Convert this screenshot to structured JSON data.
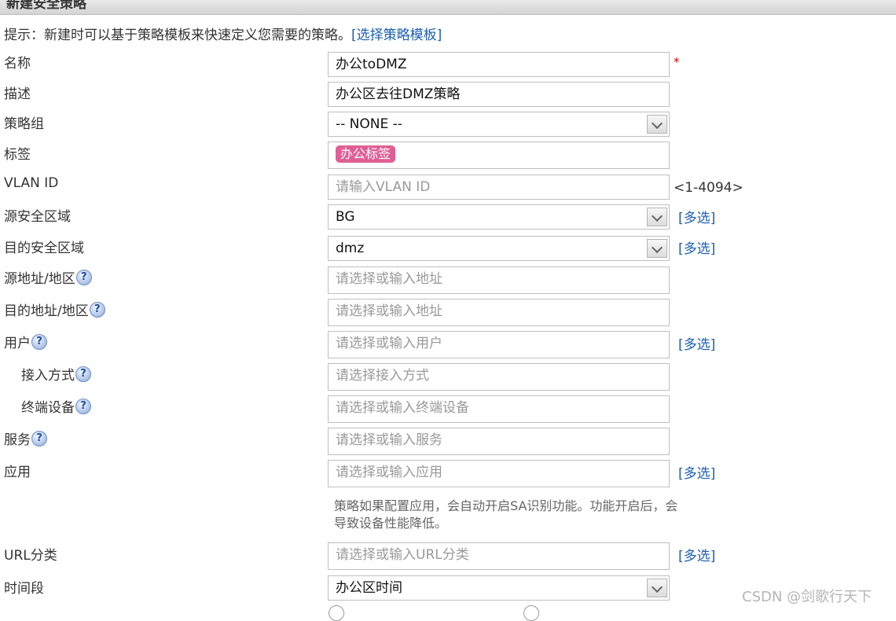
{
  "window": {
    "title": "新建安全策略"
  },
  "hint": {
    "text": "提示：新建时可以基于策略模板来快速定义您需要的策略。",
    "link": "[选择策略模板]"
  },
  "fields": {
    "name": {
      "label": "名称",
      "value": "办公toDMZ",
      "required_mark": "*"
    },
    "description": {
      "label": "描述",
      "value": "办公区去往DMZ策略"
    },
    "policy_group": {
      "label": "策略组",
      "value": "-- NONE --"
    },
    "tags": {
      "label": "标签",
      "tag": "办公标签",
      "tag_color": "#e05f95"
    },
    "vlan_id": {
      "label": "VLAN ID",
      "placeholder": "请输入VLAN ID",
      "range": "<1-4094>"
    },
    "src_zone": {
      "label": "源安全区域",
      "value": "BG",
      "multi": "[多选]"
    },
    "dst_zone": {
      "label": "目的安全区域",
      "value": "dmz",
      "multi": "[多选]"
    },
    "src_addr": {
      "label": "源地址/地区",
      "placeholder": "请选择或输入地址"
    },
    "dst_addr": {
      "label": "目的地址/地区",
      "placeholder": "请选择或输入地址"
    },
    "user": {
      "label": "用户",
      "placeholder": "请选择或输入用户",
      "multi": "[多选]"
    },
    "access_mode": {
      "label": "接入方式",
      "placeholder": "请选择接入方式"
    },
    "terminal": {
      "label": "终端设备",
      "placeholder": "请选择或输入终端设备"
    },
    "service": {
      "label": "服务",
      "placeholder": "请选择或输入服务"
    },
    "application": {
      "label": "应用",
      "placeholder": "请选择或输入应用",
      "multi": "[多选]",
      "note": "策略如果配置应用，会自动开启SA识别功能。功能开启后，会导致设备性能降低。"
    },
    "url_category": {
      "label": "URL分类",
      "placeholder": "请选择或输入URL分类",
      "multi": "[多选]"
    },
    "time_range": {
      "label": "时间段",
      "value": "办公区时间"
    }
  },
  "icons": {
    "help": "help-question-icon",
    "dropdown": "chevron-down-icon"
  },
  "watermark": "CSDN @剑歌行天下",
  "colors": {
    "link": "#1a5fb4",
    "required": "#d40000",
    "title_bar": "#d4d4d4"
  }
}
